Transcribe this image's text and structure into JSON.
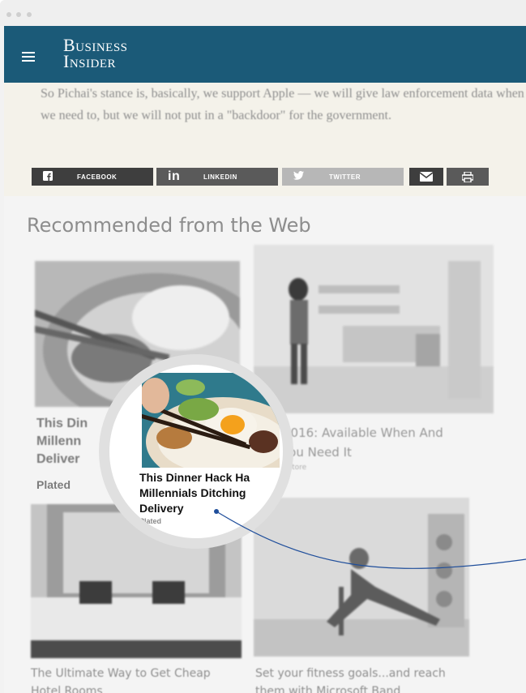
{
  "browser": {
    "dots": [
      "dot-1",
      "dot-2",
      "dot-3"
    ]
  },
  "header": {
    "logo_line1": "Business",
    "logo_line2": "Insider",
    "menu_icon": "hamburger-icon",
    "bg_color": "#1b5a78"
  },
  "article": {
    "paragraph": "So Pichai's stance is, basically, we support Apple — we will give law enforcement data when we need to, but we will not put in a \"backdoor\" for the government."
  },
  "share": {
    "facebook": "FACEBOOK",
    "linkedin": "LINKEDIN",
    "twitter": "TWITTER",
    "linkedin_glyph": "in",
    "email_icon": "envelope-icon",
    "print_icon": "printer-icon"
  },
  "recommended": {
    "heading": "Recommended from the Web",
    "cards": [
      {
        "title_line1": "This Din",
        "title_line2": "Millenn",
        "title_line3": "Deliver",
        "source": "Plated"
      },
      {
        "title_line1": "e 2016: Available When And",
        "title_line2": "e You Need It",
        "source": "ft Store"
      },
      {
        "title_line1": "The Ultimate Way to Get Cheap",
        "title_line2": "Hotel Rooms"
      },
      {
        "title_line1": "Set your fitness goals...and reach",
        "title_line2": "them with Microsoft Band"
      }
    ],
    "zoom": {
      "title_line1": "This Dinner Hack Ha",
      "title_line2": "Millennials Ditching",
      "title_line3": "Delivery",
      "source": "Plated"
    }
  },
  "colors": {
    "accent": "#1b5a78",
    "callout_line": "#1f4e9b"
  }
}
